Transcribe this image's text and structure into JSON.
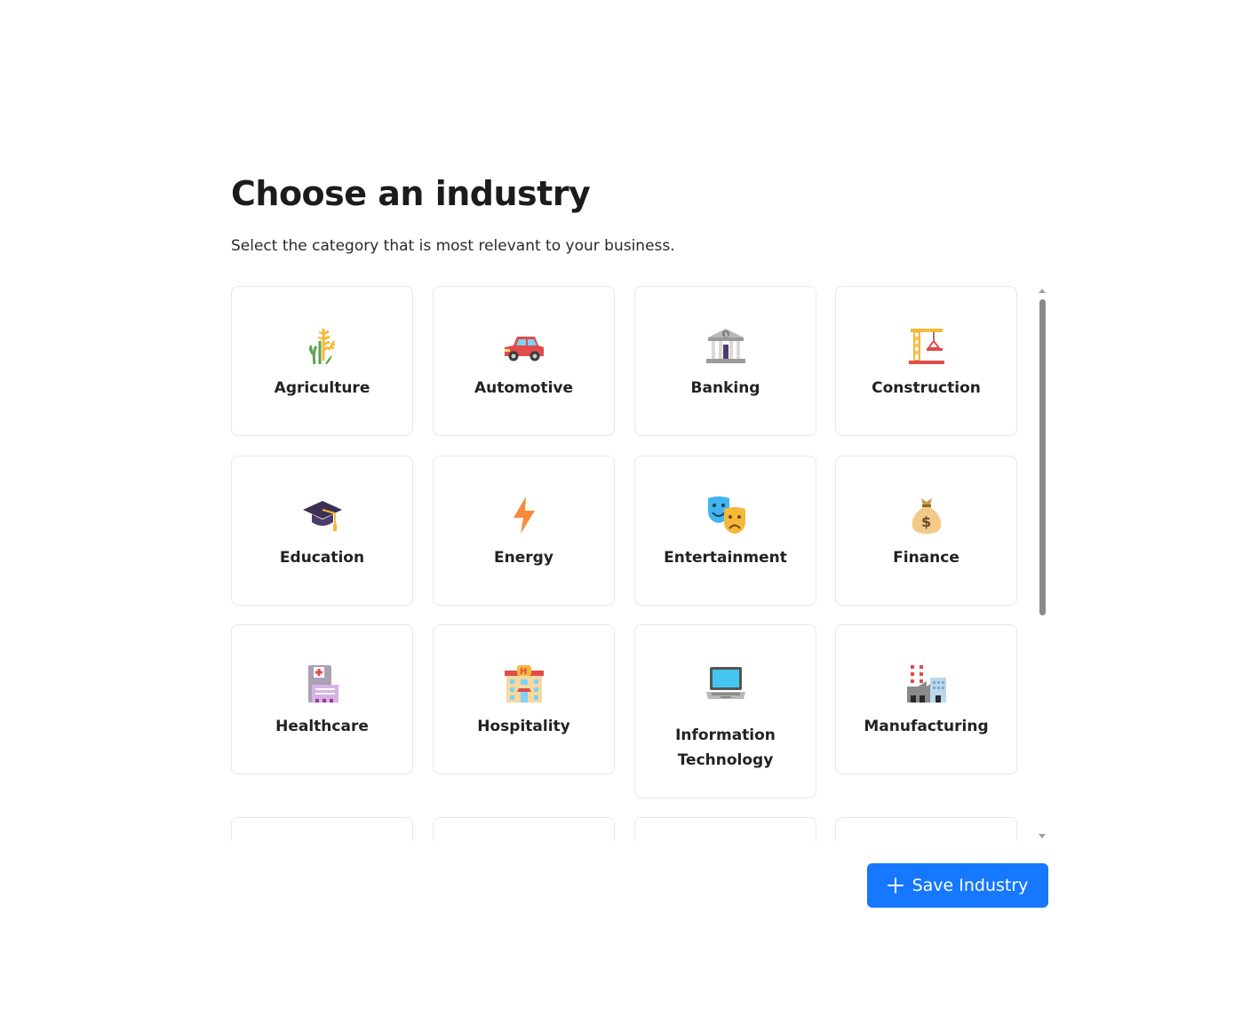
{
  "page": {
    "title": "Choose an industry",
    "subtitle": "Select the category that is most relevant to your business."
  },
  "industries": [
    {
      "label": "Agriculture",
      "icon": "agriculture-icon"
    },
    {
      "label": "Automotive",
      "icon": "car-icon"
    },
    {
      "label": "Banking",
      "icon": "bank-icon"
    },
    {
      "label": "Construction",
      "icon": "crane-icon"
    },
    {
      "label": "Education",
      "icon": "graduation-cap-icon"
    },
    {
      "label": "Energy",
      "icon": "lightning-icon"
    },
    {
      "label": "Entertainment",
      "icon": "theater-masks-icon"
    },
    {
      "label": "Finance",
      "icon": "money-bag-icon"
    },
    {
      "label": "Healthcare",
      "icon": "hospital-icon"
    },
    {
      "label": "Hospitality",
      "icon": "hotel-icon"
    },
    {
      "label": "Information Technology",
      "icon": "laptop-icon"
    },
    {
      "label": "Manufacturing",
      "icon": "factory-icon"
    }
  ],
  "actions": {
    "save_label": "Save Industry"
  },
  "colors": {
    "primary": "#1677ff",
    "card_border": "#e7e7e7",
    "text": "#1c1c1c"
  }
}
